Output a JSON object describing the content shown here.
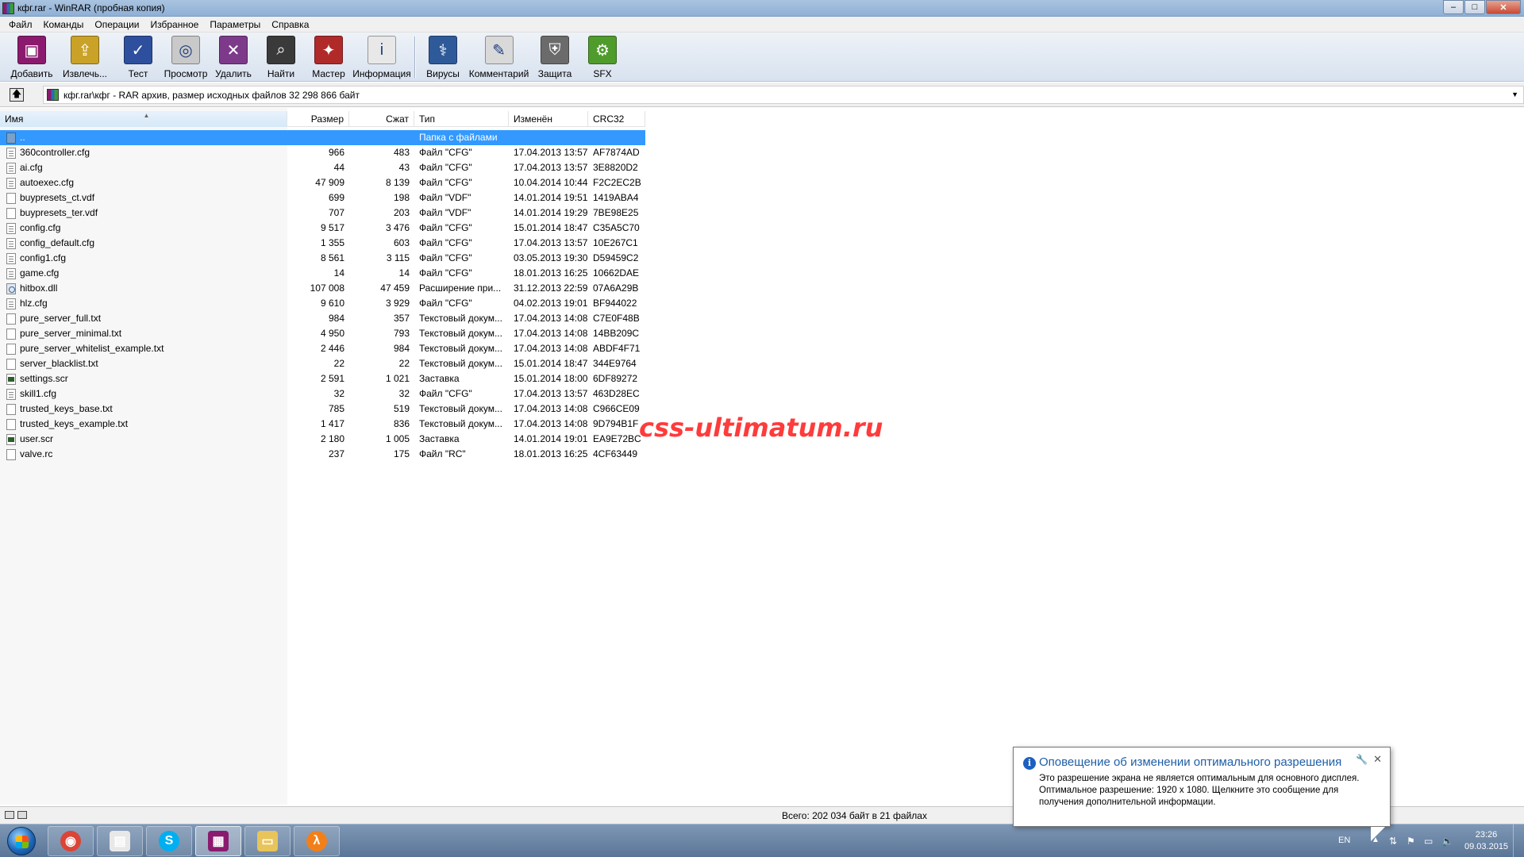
{
  "window": {
    "title": "кфг.rar - WinRAR (пробная копия)",
    "buttons": {
      "minimize": "–",
      "maximize": "□",
      "close": "✕"
    }
  },
  "menu": [
    "Файл",
    "Команды",
    "Операции",
    "Избранное",
    "Параметры",
    "Справка"
  ],
  "toolbar": [
    {
      "label": "Добавить",
      "icon": "add-archive-icon",
      "color": "#8b1a6e"
    },
    {
      "label": "Извлечь...",
      "icon": "extract-folder-icon",
      "color": "#c9a227"
    },
    {
      "label": "Тест",
      "icon": "test-book-icon",
      "color": "#2d4f9e"
    },
    {
      "label": "Просмотр",
      "icon": "view-glasses-icon",
      "color": "#c9c9c9"
    },
    {
      "label": "Удалить",
      "icon": "delete-archive-icon",
      "color": "#7d3a8a"
    },
    {
      "label": "Найти",
      "icon": "binoculars-icon",
      "color": "#3a3a3a"
    },
    {
      "label": "Мастер",
      "icon": "wizard-icon",
      "color": "#b02a2a"
    },
    {
      "label": "Информация",
      "icon": "info-icon",
      "color": "#e8e8e8"
    },
    {
      "label": "Вирусы",
      "icon": "virus-scan-icon",
      "color": "#2f5a9a"
    },
    {
      "label": "Комментарий",
      "icon": "comment-icon",
      "color": "#d9d9d9"
    },
    {
      "label": "Защита",
      "icon": "shield-icon",
      "color": "#6b6b6b"
    },
    {
      "label": "SFX",
      "icon": "sfx-icon",
      "color": "#4f9b2c"
    }
  ],
  "address": {
    "path": "кфг.rar\\кфг - RAR архив, размер исходных файлов 32 298 866 байт",
    "dropdown": "▼",
    "up": "🡅"
  },
  "columns": {
    "name": "Имя",
    "size": "Размер",
    "packed": "Сжат",
    "type": "Тип",
    "modified": "Изменён",
    "crc": "CRC32"
  },
  "files": [
    {
      "name": "..",
      "size": "",
      "packed": "",
      "type": "Папка с файлами",
      "modified": "",
      "crc": "",
      "icon": "folder"
    },
    {
      "name": "360controller.cfg",
      "size": "966",
      "packed": "483",
      "type": "Файл \"CFG\"",
      "modified": "17.04.2013 13:57",
      "crc": "AF7874AD",
      "icon": "cfg"
    },
    {
      "name": "ai.cfg",
      "size": "44",
      "packed": "43",
      "type": "Файл \"CFG\"",
      "modified": "17.04.2013 13:57",
      "crc": "3E8820D2",
      "icon": "cfg"
    },
    {
      "name": "autoexec.cfg",
      "size": "47 909",
      "packed": "8 139",
      "type": "Файл \"CFG\"",
      "modified": "10.04.2014 10:44",
      "crc": "F2C2EC2B",
      "icon": "cfg"
    },
    {
      "name": "buypresets_ct.vdf",
      "size": "699",
      "packed": "198",
      "type": "Файл \"VDF\"",
      "modified": "14.01.2014 19:51",
      "crc": "1419ABA4",
      "icon": "blank"
    },
    {
      "name": "buypresets_ter.vdf",
      "size": "707",
      "packed": "203",
      "type": "Файл \"VDF\"",
      "modified": "14.01.2014 19:29",
      "crc": "7BE98E25",
      "icon": "blank"
    },
    {
      "name": "config.cfg",
      "size": "9 517",
      "packed": "3 476",
      "type": "Файл \"CFG\"",
      "modified": "15.01.2014 18:47",
      "crc": "C35A5C70",
      "icon": "cfg"
    },
    {
      "name": "config_default.cfg",
      "size": "1 355",
      "packed": "603",
      "type": "Файл \"CFG\"",
      "modified": "17.04.2013 13:57",
      "crc": "10E267C1",
      "icon": "cfg"
    },
    {
      "name": "config1.cfg",
      "size": "8 561",
      "packed": "3 115",
      "type": "Файл \"CFG\"",
      "modified": "03.05.2013 19:30",
      "crc": "D59459C2",
      "icon": "cfg"
    },
    {
      "name": "game.cfg",
      "size": "14",
      "packed": "14",
      "type": "Файл \"CFG\"",
      "modified": "18.01.2013 16:25",
      "crc": "10662DAE",
      "icon": "cfg"
    },
    {
      "name": "hitbox.dll",
      "size": "107 008",
      "packed": "47 459",
      "type": "Расширение при...",
      "modified": "31.12.2013 22:59",
      "crc": "07A6A29B",
      "icon": "dll"
    },
    {
      "name": "hlz.cfg",
      "size": "9 610",
      "packed": "3 929",
      "type": "Файл \"CFG\"",
      "modified": "04.02.2013 19:01",
      "crc": "BF944022",
      "icon": "cfg"
    },
    {
      "name": "pure_server_full.txt",
      "size": "984",
      "packed": "357",
      "type": "Текстовый докум...",
      "modified": "17.04.2013 14:08",
      "crc": "C7E0F48B",
      "icon": "blank"
    },
    {
      "name": "pure_server_minimal.txt",
      "size": "4 950",
      "packed": "793",
      "type": "Текстовый докум...",
      "modified": "17.04.2013 14:08",
      "crc": "14BB209C",
      "icon": "blank"
    },
    {
      "name": "pure_server_whitelist_example.txt",
      "size": "2 446",
      "packed": "984",
      "type": "Текстовый докум...",
      "modified": "17.04.2013 14:08",
      "crc": "ABDF4F71",
      "icon": "blank"
    },
    {
      "name": "server_blacklist.txt",
      "size": "22",
      "packed": "22",
      "type": "Текстовый докум...",
      "modified": "15.01.2014 18:47",
      "crc": "344E9764",
      "icon": "blank"
    },
    {
      "name": "settings.scr",
      "size": "2 591",
      "packed": "1 021",
      "type": "Заставка",
      "modified": "15.01.2014 18:00",
      "crc": "6DF89272",
      "icon": "scr"
    },
    {
      "name": "skill1.cfg",
      "size": "32",
      "packed": "32",
      "type": "Файл \"CFG\"",
      "modified": "17.04.2013 13:57",
      "crc": "463D28EC",
      "icon": "cfg"
    },
    {
      "name": "trusted_keys_base.txt",
      "size": "785",
      "packed": "519",
      "type": "Текстовый докум...",
      "modified": "17.04.2013 14:08",
      "crc": "C966CE09",
      "icon": "blank"
    },
    {
      "name": "trusted_keys_example.txt",
      "size": "1 417",
      "packed": "836",
      "type": "Текстовый докум...",
      "modified": "17.04.2013 14:08",
      "crc": "9D794B1F",
      "icon": "blank"
    },
    {
      "name": "user.scr",
      "size": "2 180",
      "packed": "1 005",
      "type": "Заставка",
      "modified": "14.01.2014 19:01",
      "crc": "EA9E72BC",
      "icon": "scr"
    },
    {
      "name": "valve.rc",
      "size": "237",
      "packed": "175",
      "type": "Файл \"RC\"",
      "modified": "18.01.2013 16:25",
      "crc": "4CF63449",
      "icon": "blank"
    }
  ],
  "watermark": "css-ultimatum.ru",
  "status": {
    "text": "Всего: 202 034 байт в 21 файлах"
  },
  "notification": {
    "title": "Оповещение об изменении оптимального разрешения",
    "line1": "Это разрешение экрана не является оптимальным для основного дисплея.",
    "line2": "Оптимальное разрешение: 1920 x 1080. Щелкните это сообщение для",
    "line3": "получения дополнительной информации.",
    "close": "✕",
    "options": "🔧"
  },
  "taskbar": {
    "apps": [
      {
        "name": "chrome",
        "icon": "chrome-icon",
        "color": "#db4437"
      },
      {
        "name": "notepad",
        "icon": "notepad-icon",
        "color": "#e8e8e8"
      },
      {
        "name": "skype",
        "icon": "skype-icon",
        "color": "#00aff0"
      },
      {
        "name": "winrar",
        "icon": "winrar-icon",
        "color": "#8b1a6e"
      },
      {
        "name": "explorer",
        "icon": "folder-icon",
        "color": "#e8c45a"
      },
      {
        "name": "half-life",
        "icon": "half-life-icon",
        "color": "#f2801a"
      }
    ],
    "lang": "EN",
    "time": "23:26",
    "date": "09.03.2015"
  }
}
